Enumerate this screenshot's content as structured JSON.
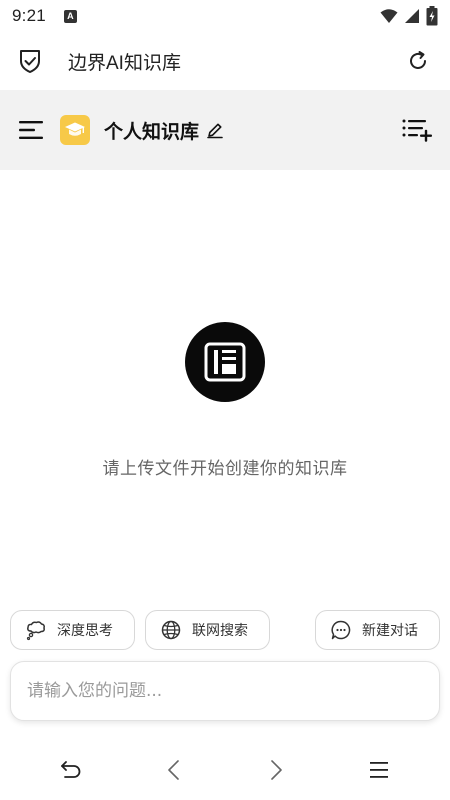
{
  "status_bar": {
    "time": "9:21",
    "app_badge": "A",
    "icons": [
      "wifi-icon",
      "signal-icon",
      "battery-charging-icon"
    ]
  },
  "browser": {
    "title": "边界AI知识库",
    "icons": [
      "shield-check-icon",
      "reload-icon"
    ]
  },
  "header": {
    "kb_name": "个人知识库",
    "icons": [
      "menu-icon",
      "graduation-cap-icon",
      "pencil-icon",
      "list-add-icon"
    ],
    "avatar_color": "#f7c948",
    "background": "#f2f2f2"
  },
  "empty_state": {
    "message": "请上传文件开始创建你的知识库",
    "icon": "document-icon"
  },
  "chips": {
    "deep_think": "深度思考",
    "web_search": "联网搜索",
    "new_chat": "新建对话"
  },
  "input": {
    "placeholder": "请输入您的问题..."
  },
  "bottom_nav": {
    "icons": [
      "undo-icon",
      "back-icon",
      "forward-icon",
      "menu-icon"
    ]
  }
}
